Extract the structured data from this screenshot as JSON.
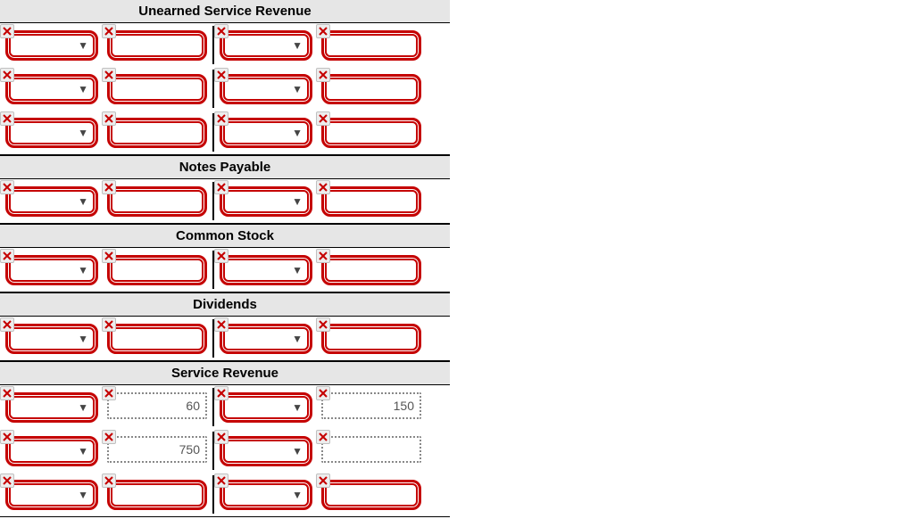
{
  "sections": [
    {
      "title": "Unearned Service Revenue",
      "rows": [
        {
          "debit": {
            "code": "",
            "amount": ""
          },
          "credit": {
            "code": "",
            "amount": ""
          },
          "style": "red"
        },
        {
          "debit": {
            "code": "",
            "amount": ""
          },
          "credit": {
            "code": "",
            "amount": ""
          },
          "style": "red"
        },
        {
          "debit": {
            "code": "",
            "amount": ""
          },
          "credit": {
            "code": "",
            "amount": ""
          },
          "style": "red"
        }
      ]
    },
    {
      "title": "Notes Payable",
      "rows": [
        {
          "debit": {
            "code": "",
            "amount": ""
          },
          "credit": {
            "code": "",
            "amount": ""
          },
          "style": "red"
        }
      ]
    },
    {
      "title": "Common Stock",
      "rows": [
        {
          "debit": {
            "code": "",
            "amount": ""
          },
          "credit": {
            "code": "",
            "amount": ""
          },
          "style": "red"
        }
      ]
    },
    {
      "title": "Dividends",
      "rows": [
        {
          "debit": {
            "code": "",
            "amount": ""
          },
          "credit": {
            "code": "",
            "amount": ""
          },
          "style": "red"
        }
      ]
    },
    {
      "title": "Service Revenue",
      "rows": [
        {
          "debit": {
            "code": "",
            "amount": "60"
          },
          "credit": {
            "code": "",
            "amount": "150"
          },
          "style": "gray"
        },
        {
          "debit": {
            "code": "",
            "amount": "750"
          },
          "credit": {
            "code": "",
            "amount": ""
          },
          "style": "gray"
        },
        {
          "debit": {
            "code": "",
            "amount": ""
          },
          "credit": {
            "code": "",
            "amount": ""
          },
          "style": "red",
          "_partial": true
        }
      ]
    }
  ]
}
